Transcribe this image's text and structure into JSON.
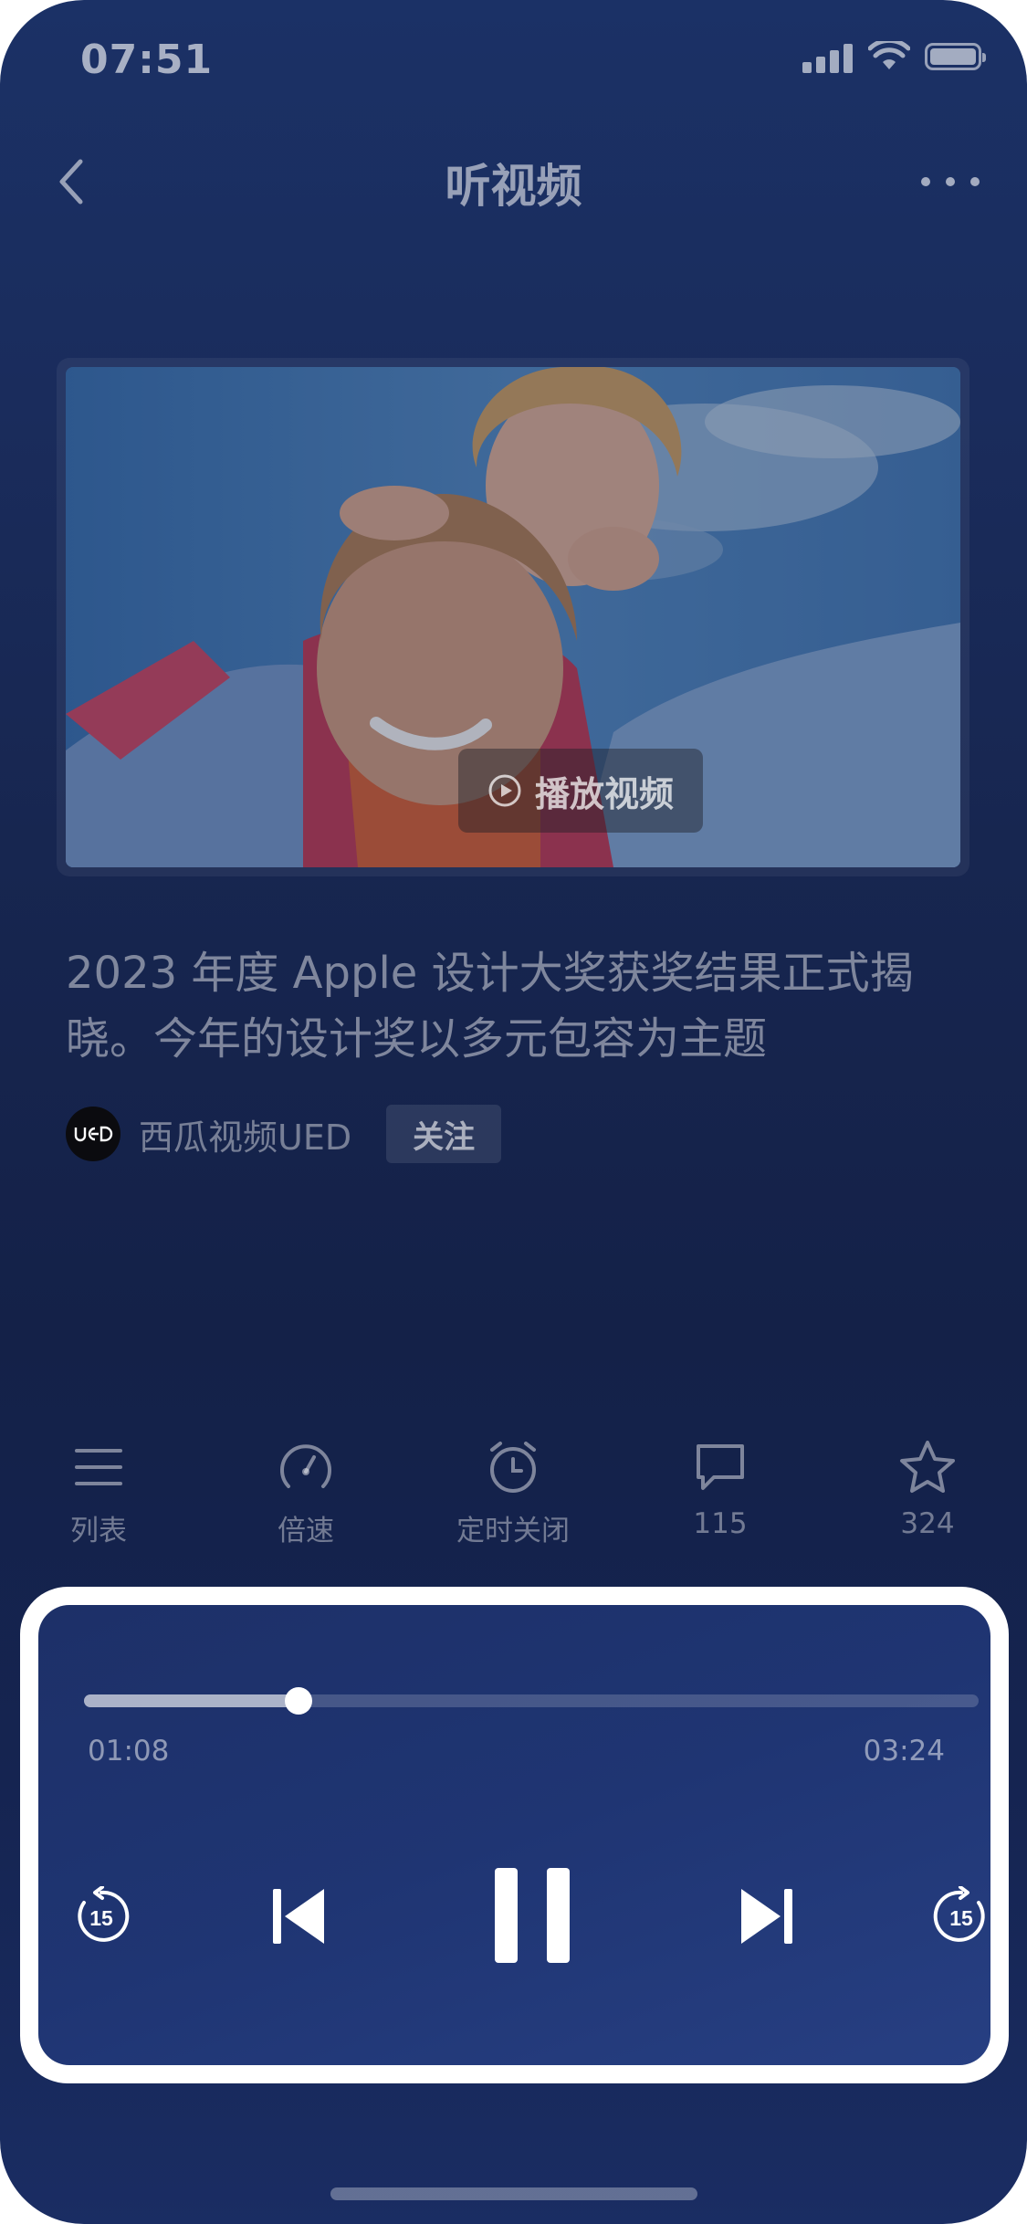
{
  "status_bar": {
    "time": "07:51",
    "signal_icon": "cellular-signal-icon",
    "wifi_icon": "wifi-icon",
    "battery_icon": "battery-icon"
  },
  "nav": {
    "title": "听视频",
    "back_icon": "chevron-left-icon",
    "more_icon": "more-horizontal-icon"
  },
  "video": {
    "play_label": "播放视频",
    "play_icon": "play-circle-icon"
  },
  "article": {
    "title": "2023 年度 Apple 设计大奖获奖结果正式揭晓。今年的设计奖以多元包容为主题"
  },
  "author": {
    "avatar_text": "UED",
    "name": "西瓜视频UED",
    "follow_label": "关注"
  },
  "actions": [
    {
      "label": "列表",
      "icon": "list-icon"
    },
    {
      "label": "倍速",
      "icon": "speedometer-icon"
    },
    {
      "label": "定时关闭",
      "icon": "alarm-clock-icon"
    },
    {
      "label": "115",
      "icon": "comment-icon"
    },
    {
      "label": "324",
      "icon": "star-icon"
    }
  ],
  "player": {
    "current_time": "01:08",
    "total_time": "03:24",
    "progress": 0.24,
    "rewind_seconds": "15",
    "forward_seconds": "15",
    "rewind_icon": "rewind-15-icon",
    "prev_icon": "skip-previous-icon",
    "pause_icon": "pause-icon",
    "next_icon": "skip-next-icon",
    "forward_icon": "forward-15-icon"
  },
  "colors": {
    "background": "#172650",
    "player_bg": "#1f3573",
    "highlight_frame": "#ffffff"
  }
}
